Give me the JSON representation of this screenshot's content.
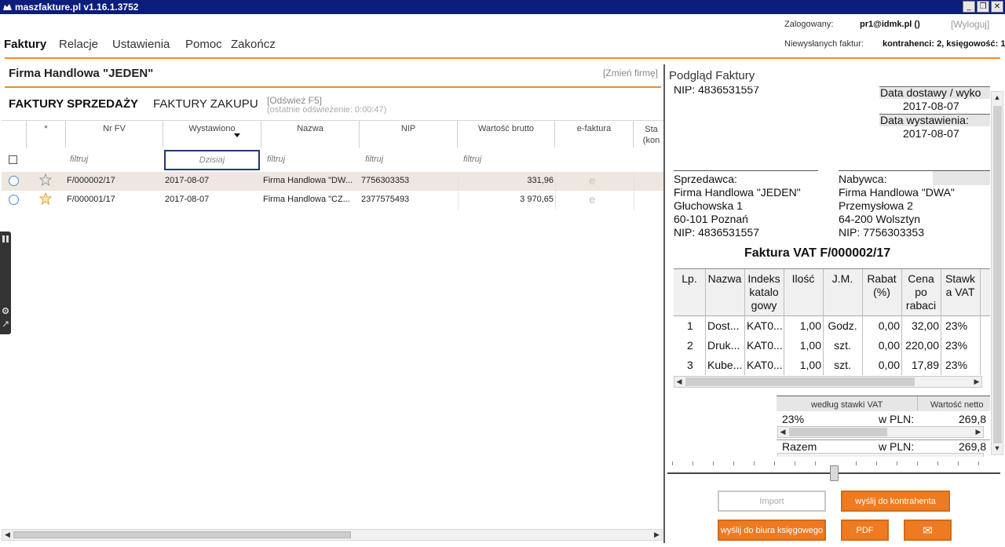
{
  "window": {
    "title": "maszfakture.pl  v1.16.1.3752",
    "min_glyph": "_",
    "max_glyph": "❐",
    "close_glyph": "✕"
  },
  "menu": {
    "items": [
      "Faktury",
      "Relacje",
      "Ustawienia",
      "Pomoc",
      "Zakończ"
    ]
  },
  "user": {
    "logged_label": "Zalogowany:",
    "login": "pr1@idmk.pl ()",
    "logout": "[Wyloguj]",
    "unsent_label": "Niewysłanych faktur:",
    "unsent_value": "kontrahenci: 2, księgowość: 1"
  },
  "left": {
    "company_name": "Firma Handlowa \"JEDEN\"",
    "change_company": "[Zmień firmę]",
    "tab_sales": "FAKTURY SPRZEDAŻY",
    "tab_purchases": "FAKTURY ZAKUPU",
    "refresh": "[Odśwież F5]",
    "refresh_time": "(ostatnie odświeżenie: 0:00:47)"
  },
  "grid": {
    "columns": [
      "*",
      "Nr FV",
      "Wystawiono",
      "Nazwa",
      "NIP",
      "Wartość brutto",
      "e-faktura",
      "Sta\n(kon"
    ],
    "filter_placeholder": "filtruj",
    "date_filter": "Dzisiaj",
    "efaktura_glyph": "e",
    "rows": [
      {
        "nr": "F/000002/17",
        "date": "2017-08-07",
        "name": "Firma Handlowa \"DW...",
        "nip": "7756303353",
        "value": "331,96"
      },
      {
        "nr": "F/000001/17",
        "date": "2017-08-07",
        "name": "Firma Handlowa \"CZ...",
        "nip": "2377575493",
        "value": "3 970,65"
      }
    ]
  },
  "preview": {
    "title": "Podgląd Faktury",
    "seller_nip_top": "NIP: 4836531557",
    "delivery_label": "Data dostawy / wyko",
    "delivery_date": "2017-08-07",
    "issue_label": "Data wystawienia:",
    "issue_date": "2017-08-07",
    "seller_label": "Sprzedawca:",
    "seller": [
      "Firma Handlowa \"JEDEN\"",
      "Głuchowska 1",
      "60-101 Poznań",
      "NIP: 4836531557"
    ],
    "buyer_label": "Nabywca:",
    "buyer": [
      "Firma Handlowa \"DWA\"",
      "Przemysłowa 2",
      "64-200 Wolsztyn",
      "NIP: 7756303353"
    ],
    "invoice_title": "Faktura VAT F/000002/17",
    "item_headers": [
      "Lp.",
      "Nazwa",
      "Indeks\nkatalo\ngowy",
      "Ilość",
      "J.M.",
      "Rabat\n(%)",
      "Cena\npo\nrabaci",
      "Stawk\na VAT"
    ],
    "items": [
      {
        "lp": "1",
        "name": "Dost...",
        "index": "KAT0...",
        "qty": "1,00",
        "unit": "Godz.",
        "disc": "0,00",
        "price": "32,00",
        "vat": "23%"
      },
      {
        "lp": "2",
        "name": "Druk...",
        "index": "KAT0...",
        "qty": "1,00",
        "unit": "szt.",
        "disc": "0,00",
        "price": "220,00",
        "vat": "23%"
      },
      {
        "lp": "3",
        "name": "Kube...",
        "index": "KAT0...",
        "qty": "1,00",
        "unit": "szt.",
        "disc": "0,00",
        "price": "17,89",
        "vat": "23%"
      }
    ],
    "summary_col1": "według stawki VAT",
    "summary_col2": "Wartość netto",
    "summary_rate": "23%",
    "currency_label": "w PLN:",
    "summary_value": "269,8",
    "total_label": "Razem",
    "total_value": "269,8"
  },
  "actions": {
    "import": "Import",
    "send_contractor": "wyślij do kontrahenta",
    "send_office": "wyślij do biura księgowego",
    "pdf": "PDF",
    "email_glyph": "✉"
  }
}
